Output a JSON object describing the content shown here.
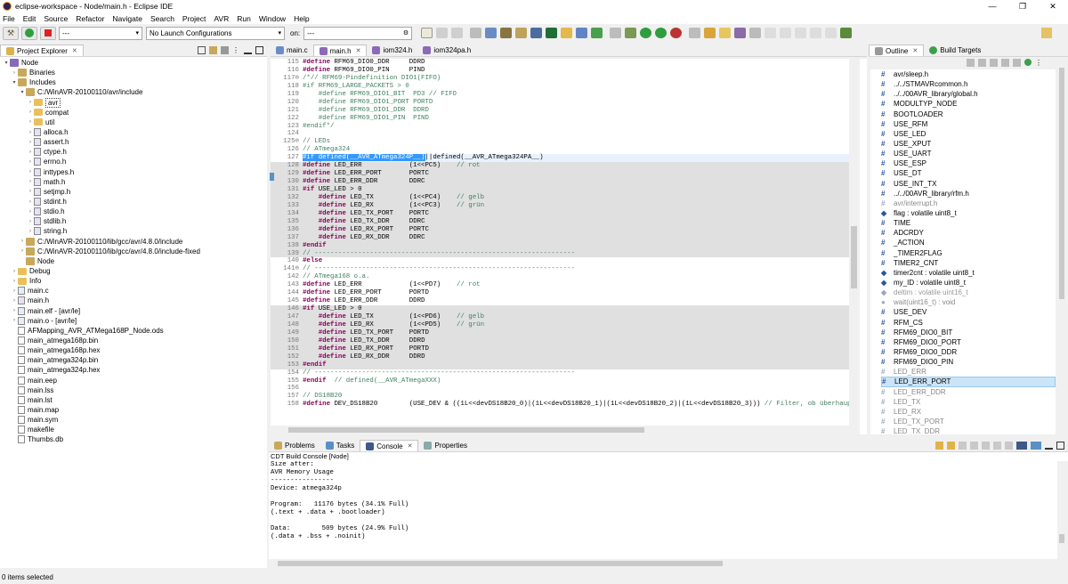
{
  "window": {
    "title": "eclipse-workspace - Node/main.h - Eclipse IDE",
    "minimize": "—",
    "maximize": "❐",
    "close": "✕"
  },
  "menu": [
    "File",
    "Edit",
    "Source",
    "Refactor",
    "Navigate",
    "Search",
    "Project",
    "AVR",
    "Run",
    "Window",
    "Help"
  ],
  "toolbar": {
    "launch_mode": "---",
    "launch_config": "No Launch Configurations",
    "on_label": "on:",
    "target": "---"
  },
  "project_explorer": {
    "tab_label": "Project Explorer",
    "rows": [
      {
        "label": "Node",
        "indent": 0,
        "tw": "▾",
        "icon": "proj"
      },
      {
        "label": "Binaries",
        "indent": 1,
        "tw": "›",
        "icon": "lib"
      },
      {
        "label": "Includes",
        "indent": 1,
        "tw": "▾",
        "icon": "lib"
      },
      {
        "label": "C:/WinAVR-20100110/avr/include",
        "indent": 2,
        "tw": "▾",
        "icon": "lib"
      },
      {
        "label": "avr",
        "indent": 3,
        "tw": "›",
        "icon": "folder",
        "boxed": true
      },
      {
        "label": "compat",
        "indent": 3,
        "tw": "›",
        "icon": "folder"
      },
      {
        "label": "util",
        "indent": 3,
        "tw": "›",
        "icon": "folder"
      },
      {
        "label": "alloca.h",
        "indent": 3,
        "tw": "›",
        "icon": "h"
      },
      {
        "label": "assert.h",
        "indent": 3,
        "tw": "›",
        "icon": "h"
      },
      {
        "label": "ctype.h",
        "indent": 3,
        "tw": "›",
        "icon": "h"
      },
      {
        "label": "errno.h",
        "indent": 3,
        "tw": "›",
        "icon": "h"
      },
      {
        "label": "inttypes.h",
        "indent": 3,
        "tw": "›",
        "icon": "h"
      },
      {
        "label": "math.h",
        "indent": 3,
        "tw": "›",
        "icon": "h"
      },
      {
        "label": "setjmp.h",
        "indent": 3,
        "tw": "›",
        "icon": "h"
      },
      {
        "label": "stdint.h",
        "indent": 3,
        "tw": "›",
        "icon": "h"
      },
      {
        "label": "stdio.h",
        "indent": 3,
        "tw": "›",
        "icon": "h"
      },
      {
        "label": "stdlib.h",
        "indent": 3,
        "tw": "›",
        "icon": "h"
      },
      {
        "label": "string.h",
        "indent": 3,
        "tw": "›",
        "icon": "h"
      },
      {
        "label": "C:/WinAVR-20100110/lib/gcc/avr/4.8.0/include",
        "indent": 2,
        "tw": "›",
        "icon": "lib"
      },
      {
        "label": "C:/WinAVR-20100110/lib/gcc/avr/4.8.0/include-fixed",
        "indent": 2,
        "tw": "›",
        "icon": "lib"
      },
      {
        "label": "Node",
        "indent": 2,
        "tw": "",
        "icon": "lib"
      },
      {
        "label": "Debug",
        "indent": 1,
        "tw": "›",
        "icon": "folder"
      },
      {
        "label": "Info",
        "indent": 1,
        "tw": "›",
        "icon": "folder"
      },
      {
        "label": "main.c",
        "indent": 1,
        "tw": "›",
        "icon": "c"
      },
      {
        "label": "main.h",
        "indent": 1,
        "tw": "›",
        "icon": "h"
      },
      {
        "label": "main.elf - [avr/le]",
        "indent": 1,
        "tw": "›",
        "icon": "c"
      },
      {
        "label": "main.o - [avr/le]",
        "indent": 1,
        "tw": "›",
        "icon": "c"
      },
      {
        "label": "AFMapping_AVR_ATMega168P_Node.ods",
        "indent": 1,
        "tw": "",
        "icon": "file"
      },
      {
        "label": "main_atmega168p.bin",
        "indent": 1,
        "tw": "",
        "icon": "file"
      },
      {
        "label": "main_atmega168p.hex",
        "indent": 1,
        "tw": "",
        "icon": "file"
      },
      {
        "label": "main_atmega324p.bin",
        "indent": 1,
        "tw": "",
        "icon": "file"
      },
      {
        "label": "main_atmega324p.hex",
        "indent": 1,
        "tw": "",
        "icon": "file"
      },
      {
        "label": "main.eep",
        "indent": 1,
        "tw": "",
        "icon": "file"
      },
      {
        "label": "main.lss",
        "indent": 1,
        "tw": "",
        "icon": "file"
      },
      {
        "label": "main.lst",
        "indent": 1,
        "tw": "",
        "icon": "file"
      },
      {
        "label": "main.map",
        "indent": 1,
        "tw": "",
        "icon": "file"
      },
      {
        "label": "main.sym",
        "indent": 1,
        "tw": "",
        "icon": "file"
      },
      {
        "label": "makefile",
        "indent": 1,
        "tw": "",
        "icon": "file"
      },
      {
        "label": "Thumbs.db",
        "indent": 1,
        "tw": "",
        "icon": "file"
      }
    ]
  },
  "editor_tabs": [
    {
      "label": "main.c",
      "active": false
    },
    {
      "label": "main.h",
      "active": true
    },
    {
      "label": "iom324.h",
      "active": false
    },
    {
      "label": "iom324pa.h",
      "active": false
    }
  ],
  "code_lines": [
    {
      "n": "115",
      "t": "#define RFM69_DIO0_DDR     DDRD",
      "k": "def"
    },
    {
      "n": "116",
      "t": "#define RFM69_DIO0_PIN     PIND",
      "k": "def"
    },
    {
      "n": "117⊖",
      "t": "/*// RFM69-Pindefinition DIO1(FIFO)",
      "k": "cm"
    },
    {
      "n": "118",
      "t": "#if RFM69_LARGE_PACKETS > 0",
      "k": "cm"
    },
    {
      "n": "119",
      "t": "    #define RFM69_DIO1_BIT  PD3 // FIFO",
      "k": "cm"
    },
    {
      "n": "120",
      "t": "    #define RFM69_DIO1_PORT PORTD",
      "k": "cm"
    },
    {
      "n": "121",
      "t": "    #define RFM69_DIO1_DDR  DDRD",
      "k": "cm"
    },
    {
      "n": "122",
      "t": "    #define RFM69_DIO1_PIN  PIND",
      "k": "cm"
    },
    {
      "n": "123",
      "t": "#endif*/",
      "k": "cm"
    },
    {
      "n": "124",
      "t": "",
      "k": ""
    },
    {
      "n": "125⊖",
      "t": "// LEDs",
      "k": "cm"
    },
    {
      "n": "126",
      "t": "// ATmega324",
      "k": "cm"
    },
    {
      "n": "127",
      "t": "#if defined(__AVR_ATmega324P__)||defined(__AVR_ATmega324PA__)",
      "k": "sel"
    },
    {
      "n": "128",
      "t": "#define LED_ERR            (1<<PC5)    // rot",
      "k": "def",
      "inact": true
    },
    {
      "n": "129",
      "t": "#define LED_ERR_PORT       PORTC",
      "k": "def",
      "inact": true
    },
    {
      "n": "130",
      "t": "#define LED_ERR_DDR        DDRC",
      "k": "def",
      "inact": true
    },
    {
      "n": "131",
      "t": "#if USE_LED > 0",
      "k": "def",
      "inact": true
    },
    {
      "n": "132",
      "t": "    #define LED_TX         (1<<PC4)    // gelb",
      "k": "def",
      "inact": true
    },
    {
      "n": "133",
      "t": "    #define LED_RX         (1<<PC3)    // grün",
      "k": "def",
      "inact": true
    },
    {
      "n": "134",
      "t": "    #define LED_TX_PORT    PORTC",
      "k": "def",
      "inact": true
    },
    {
      "n": "135",
      "t": "    #define LED_TX_DDR     DDRC",
      "k": "def",
      "inact": true
    },
    {
      "n": "136",
      "t": "    #define LED_RX_PORT    PORTC",
      "k": "def",
      "inact": true
    },
    {
      "n": "137",
      "t": "    #define LED_RX_DDR     DDRC",
      "k": "def",
      "inact": true
    },
    {
      "n": "138",
      "t": "#endif",
      "k": "def",
      "inact": true
    },
    {
      "n": "139",
      "t": "// ------------------------------------------------------------------",
      "k": "cm",
      "inact": true
    },
    {
      "n": "140",
      "t": "#else",
      "k": "def"
    },
    {
      "n": "141⊖",
      "t": "// ------------------------------------------------------------------",
      "k": "cm"
    },
    {
      "n": "142",
      "t": "// ATmega168 o.a.",
      "k": "cm"
    },
    {
      "n": "143",
      "t": "#define LED_ERR            (1<<PD7)    // rot",
      "k": "def"
    },
    {
      "n": "144",
      "t": "#define LED_ERR_PORT       PORTD",
      "k": "def"
    },
    {
      "n": "145",
      "t": "#define LED_ERR_DDR        DDRD",
      "k": "def"
    },
    {
      "n": "146",
      "t": "#if USE_LED > 0",
      "k": "def",
      "inact": true
    },
    {
      "n": "147",
      "t": "    #define LED_TX         (1<<PD6)    // gelb",
      "k": "def",
      "inact": true
    },
    {
      "n": "148",
      "t": "    #define LED_RX         (1<<PD5)    // grün",
      "k": "def",
      "inact": true
    },
    {
      "n": "149",
      "t": "    #define LED_TX_PORT    PORTD",
      "k": "def",
      "inact": true
    },
    {
      "n": "150",
      "t": "    #define LED_TX_DDR     DDRD",
      "k": "def",
      "inact": true
    },
    {
      "n": "151",
      "t": "    #define LED_RX_PORT    PORTD",
      "k": "def",
      "inact": true
    },
    {
      "n": "152",
      "t": "    #define LED_RX_DDR     DDRD",
      "k": "def",
      "inact": true
    },
    {
      "n": "153",
      "t": "#endif",
      "k": "def",
      "inact": true
    },
    {
      "n": "154",
      "t": "// ------------------------------------------------------------------",
      "k": "cm"
    },
    {
      "n": "155",
      "t": "#endif  // defined(__AVR_ATmegaXXX)",
      "k": "def"
    },
    {
      "n": "156",
      "t": "",
      "k": ""
    },
    {
      "n": "157",
      "t": "// DS18B20",
      "k": "cm"
    },
    {
      "n": "158",
      "t": "#define DEV_DS18B20        (USE_DEV & ((1L<<devDS18B20_0)|(1L<<devDS18B20_1)|(1L<<devDS18B20_2)|(1L<<devDS18B20_3))) // Filter, ob überhaupt s",
      "k": "def"
    }
  ],
  "outline": {
    "tabs": [
      "Outline",
      "Build Targets"
    ],
    "items": [
      {
        "label": "avr/sleep.h",
        "type": "inc"
      },
      {
        "label": "../../STMAVRcommon.h",
        "type": "inc"
      },
      {
        "label": "../../00AVR_library/global.h",
        "type": "inc"
      },
      {
        "label": "MODULTYP_NODE",
        "type": "def"
      },
      {
        "label": "BOOTLOADER",
        "type": "def"
      },
      {
        "label": "USE_RFM",
        "type": "def"
      },
      {
        "label": "USE_LED",
        "type": "def"
      },
      {
        "label": "USE_XPUT",
        "type": "def"
      },
      {
        "label": "USE_UART",
        "type": "def"
      },
      {
        "label": "USE_ESP",
        "type": "def"
      },
      {
        "label": "USE_DT",
        "type": "def"
      },
      {
        "label": "USE_INT_TX",
        "type": "def"
      },
      {
        "label": "../../00AVR_library/rfm.h",
        "type": "inc"
      },
      {
        "label": "avr/interrupt.h",
        "type": "inc",
        "gray": true
      },
      {
        "label": "flag : volatile uint8_t",
        "type": "var"
      },
      {
        "label": "TIME",
        "type": "def"
      },
      {
        "label": "ADCRDY",
        "type": "def"
      },
      {
        "label": "_ACTION",
        "type": "def"
      },
      {
        "label": "_TIMER2FLAG",
        "type": "def"
      },
      {
        "label": "TIMER2_CNT",
        "type": "def"
      },
      {
        "label": "timer2cnt : volatile uint8_t",
        "type": "var"
      },
      {
        "label": "my_ID : volatile uint8_t",
        "type": "var"
      },
      {
        "label": "deltim : volatile uint16_t",
        "type": "var",
        "gray": true
      },
      {
        "label": "wait(uint16_t) : void",
        "type": "fn",
        "gray": true
      },
      {
        "label": "USE_DEV",
        "type": "def"
      },
      {
        "label": "RFM_CS",
        "type": "def"
      },
      {
        "label": "RFM69_DIO0_BIT",
        "type": "def"
      },
      {
        "label": "RFM69_DIO0_PORT",
        "type": "def"
      },
      {
        "label": "RFM69_DIO0_DDR",
        "type": "def"
      },
      {
        "label": "RFM69_DIO0_PIN",
        "type": "def"
      },
      {
        "label": "LED_ERR",
        "type": "def",
        "gray": true
      },
      {
        "label": "LED_ERR_PORT",
        "type": "def",
        "selected": true
      },
      {
        "label": "LED_ERR_DDR",
        "type": "def",
        "gray": true
      },
      {
        "label": "LED_TX",
        "type": "def",
        "gray": true
      },
      {
        "label": "LED_RX",
        "type": "def",
        "gray": true
      },
      {
        "label": "LED_TX_PORT",
        "type": "def",
        "gray": true
      },
      {
        "label": "LED_TX_DDR",
        "type": "def",
        "gray": true
      }
    ]
  },
  "bottom_tabs": [
    {
      "label": "Problems",
      "active": false
    },
    {
      "label": "Tasks",
      "active": false
    },
    {
      "label": "Console",
      "active": true
    },
    {
      "label": "Properties",
      "active": false
    }
  ],
  "console": {
    "header": "CDT Build Console [Node]",
    "lines": [
      "Size after:",
      "AVR Memory Usage",
      "----------------",
      "Device: atmega324p",
      "",
      "Program:   11176 bytes (34.1% Full)",
      "(.text + .data + .bootloader)",
      "",
      "Data:        509 bytes (24.9% Full)",
      "(.data + .bss + .noinit)"
    ]
  },
  "status": {
    "text": "0 items selected"
  }
}
